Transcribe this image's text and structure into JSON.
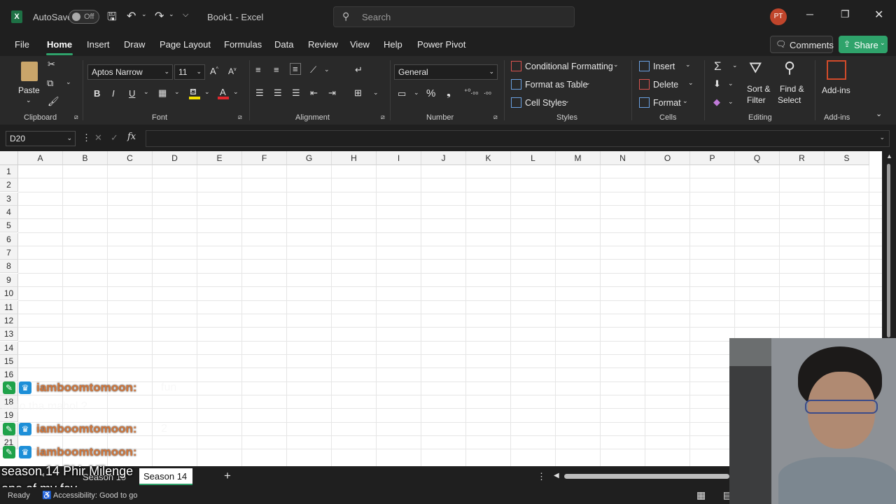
{
  "titlebar": {
    "autosave_label": "AutoSave",
    "autosave_state": "Off",
    "doc_title": "Book1  -  Excel",
    "search_placeholder": "Search",
    "user_initials": "PT",
    "accent": "#c0452b"
  },
  "menu": {
    "items": [
      "File",
      "Home",
      "Insert",
      "Draw",
      "Page Layout",
      "Formulas",
      "Data",
      "Review",
      "View",
      "Help",
      "Power Pivot"
    ],
    "active": "Home",
    "comments_label": "Comments",
    "share_label": "Share",
    "share_color": "#2fa36b"
  },
  "ribbon": {
    "clipboard": {
      "paste_label": "Paste",
      "group_label": "Clipboard"
    },
    "font": {
      "family": "Aptos Narrow",
      "size": "11",
      "group_label": "Font",
      "bold": "B",
      "italic": "I",
      "underline": "U"
    },
    "alignment": {
      "group_label": "Alignment"
    },
    "number": {
      "format": "General",
      "group_label": "Number",
      "percent": "%"
    },
    "styles": {
      "conditional": "Conditional Formatting",
      "format_table": "Format as Table",
      "cell_styles": "Cell Styles",
      "group_label": "Styles"
    },
    "cells": {
      "insert": "Insert",
      "delete": "Delete",
      "format": "Format",
      "group_label": "Cells"
    },
    "editing": {
      "sort_filter_1": "Sort &",
      "sort_filter_2": "Filter",
      "find_select_1": "Find &",
      "find_select_2": "Select",
      "group_label": "Editing"
    },
    "addins": {
      "label": "Add-ins",
      "group_label": "Add-ins"
    }
  },
  "formula_bar": {
    "name_box": "D20",
    "fx": "fx",
    "content": ""
  },
  "grid": {
    "columns": [
      "A",
      "B",
      "C",
      "D",
      "E",
      "F",
      "G",
      "H",
      "I",
      "J",
      "K",
      "L",
      "M",
      "N",
      "O",
      "P",
      "Q",
      "R",
      "S"
    ],
    "rows": [
      "1",
      "2",
      "3",
      "4",
      "5",
      "6",
      "7",
      "8",
      "9",
      "10",
      "11",
      "12",
      "13",
      "14",
      "15",
      "16",
      "17",
      "18",
      "19",
      "20",
      "21"
    ]
  },
  "chat": [
    {
      "name": "iamboomtomoon:",
      "msg": "fun"
    },
    {
      "name": "",
      "msg": "pe jo tha mahol ?"
    },
    {
      "name": "iamboomtomoon:",
      "msg": "2"
    },
    {
      "name": "iamboomtomoon:",
      "msg": ""
    }
  ],
  "overlay": {
    "line1": "season 14 Phir Milenge",
    "line2": "one of my fav"
  },
  "sheets": {
    "tabs": [
      "Season 15",
      "Season 14"
    ],
    "active": "Season 14",
    "add_label": "+"
  },
  "status": {
    "ready": "Ready",
    "accessibility": "Accessibility: Good to go"
  }
}
